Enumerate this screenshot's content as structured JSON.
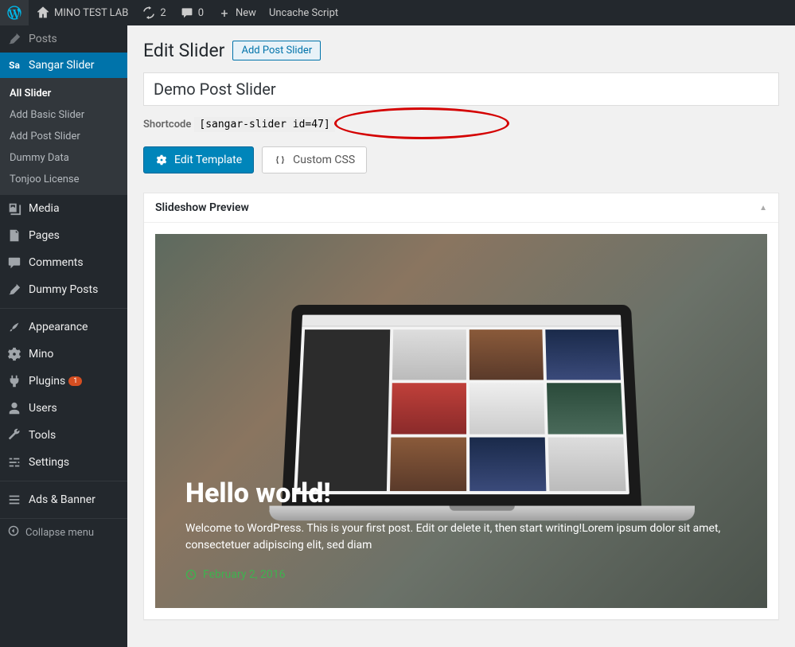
{
  "toolbar": {
    "site_name": "MINO TEST LAB",
    "updates_count": "2",
    "comments_count": "0",
    "new_label": "New",
    "uncache_label": "Uncache Script"
  },
  "sidebar": {
    "posts_label": "Posts",
    "sangar_label": "Sangar Slider",
    "sangar_prefix": "Sa",
    "submenu": {
      "all_slider": "All Slider",
      "add_basic": "Add Basic Slider",
      "add_post": "Add Post Slider",
      "dummy_data": "Dummy Data",
      "tonjoo_license": "Tonjoo License"
    },
    "media": "Media",
    "pages": "Pages",
    "comments": "Comments",
    "dummy_posts": "Dummy Posts",
    "appearance": "Appearance",
    "mino": "Mino",
    "plugins": "Plugins",
    "plugins_badge": "1",
    "users": "Users",
    "tools": "Tools",
    "settings": "Settings",
    "ads_banner": "Ads & Banner",
    "collapse": "Collapse menu"
  },
  "page": {
    "heading": "Edit Slider",
    "add_new_btn": "Add Post Slider",
    "title_value": "Demo Post Slider",
    "shortcode_label": "Shortcode",
    "shortcode_value": "[sangar-slider id=47]",
    "edit_template_btn": "Edit Template",
    "custom_css_btn": "Custom CSS",
    "preview_heading": "Slideshow Preview"
  },
  "slide": {
    "title": "Hello world!",
    "desc": "Welcome to WordPress. This is your first post. Edit or delete it, then start writing!Lorem ipsum dolor sit amet, consectetuer adipiscing elit, sed diam",
    "date": "February 2, 2016"
  }
}
